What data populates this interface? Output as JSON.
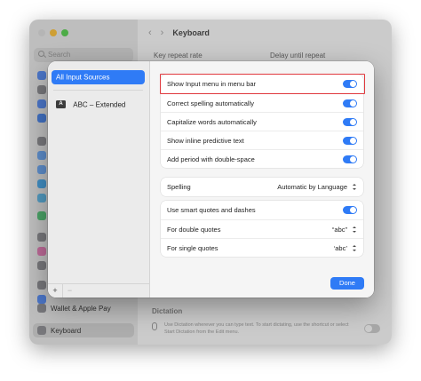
{
  "window": {
    "title": "Keyboard",
    "search_placeholder": "Search",
    "sidebar_items": [
      {
        "label": "Wallet & Apple Pay",
        "icon": "wallet-icon"
      },
      {
        "label": "Keyboard",
        "icon": "keyboard-icon"
      }
    ],
    "key_repeat_label": "Key repeat rate",
    "delay_label": "Delay until repeat",
    "dictation_title": "Dictation",
    "dictation_text": "Use Dictation wherever you can type text. To start dictating, use the shortcut or select Start Dictation from the Edit menu.",
    "colors": {
      "yellow": "#f6be3f",
      "green": "#5ccd55"
    }
  },
  "sheet": {
    "sources": [
      {
        "label": "All Input Sources",
        "selected": true
      },
      {
        "label": "ABC – Extended",
        "badge": "A",
        "selected": false
      }
    ],
    "add_label": "+",
    "remove_label": "−",
    "group1": [
      {
        "label": "Show Input menu in menu bar",
        "on": true
      },
      {
        "label": "Correct spelling automatically",
        "on": true
      },
      {
        "label": "Capitalize words automatically",
        "on": true
      },
      {
        "label": "Show inline predictive text",
        "on": true
      },
      {
        "label": "Add period with double-space",
        "on": true
      }
    ],
    "spelling": {
      "label": "Spelling",
      "value": "Automatic by Language"
    },
    "quotes_toggle": {
      "label": "Use smart quotes and dashes",
      "on": true
    },
    "double_quotes": {
      "label": "For double quotes",
      "value": "“abc”"
    },
    "single_quotes": {
      "label": "For single quotes",
      "value": "‘abc’"
    },
    "done_label": "Done",
    "colors": {
      "accent": "#2f7bf6",
      "highlight": "#e0393e"
    }
  }
}
